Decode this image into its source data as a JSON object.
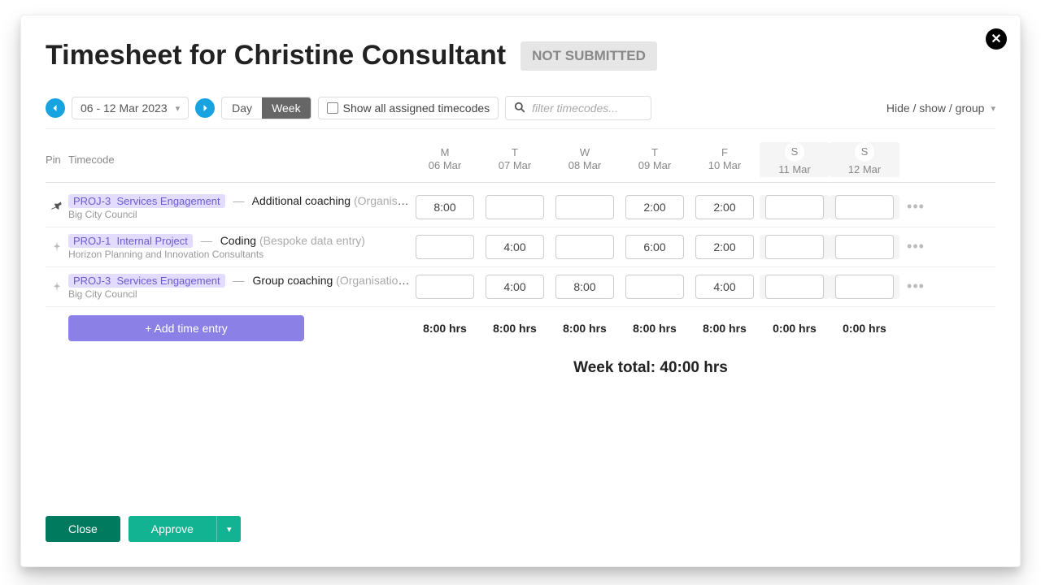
{
  "title": "Timesheet for Christine Consultant",
  "status": "NOT SUBMITTED",
  "date_range": "06 - 12 Mar 2023",
  "view": {
    "day": "Day",
    "week": "Week",
    "active": "week"
  },
  "show_all_label": "Show all assigned timecodes",
  "filter_placeholder": "filter timecodes...",
  "hide_show_label": "Hide / show / group",
  "columns": {
    "pin": "Pin",
    "timecode": "Timecode"
  },
  "days": [
    {
      "dow": "M",
      "date": "06 Mar",
      "weekend": false
    },
    {
      "dow": "T",
      "date": "07 Mar",
      "weekend": false
    },
    {
      "dow": "W",
      "date": "08 Mar",
      "weekend": false
    },
    {
      "dow": "T",
      "date": "09 Mar",
      "weekend": false
    },
    {
      "dow": "F",
      "date": "10 Mar",
      "weekend": false
    },
    {
      "dow": "S",
      "date": "11 Mar",
      "weekend": true
    },
    {
      "dow": "S",
      "date": "12 Mar",
      "weekend": true
    }
  ],
  "rows": [
    {
      "pinned": true,
      "proj_code": "PROJ-3",
      "proj_name": "Services Engagement",
      "task": "Additional coaching",
      "parens": "(Organisati...",
      "org": "Big City Council",
      "times": [
        "8:00",
        "",
        "",
        "2:00",
        "2:00",
        "",
        ""
      ]
    },
    {
      "pinned": false,
      "proj_code": "PROJ-1",
      "proj_name": "Internal Project",
      "task": "Coding",
      "parens": "(Bespoke data entry)",
      "org": "Horizon Planning and Innovation Consultants",
      "times": [
        "",
        "4:00",
        "",
        "6:00",
        "2:00",
        "",
        ""
      ]
    },
    {
      "pinned": false,
      "proj_code": "PROJ-3",
      "proj_name": "Services Engagement",
      "task": "Group coaching",
      "parens": "(Organisation fi...",
      "org": "Big City Council",
      "times": [
        "",
        "4:00",
        "8:00",
        "",
        "4:00",
        "",
        ""
      ]
    }
  ],
  "add_entry_label": "+ Add time entry",
  "day_totals": [
    "8:00 hrs",
    "8:00 hrs",
    "8:00 hrs",
    "8:00 hrs",
    "8:00 hrs",
    "0:00 hrs",
    "0:00 hrs"
  ],
  "week_total": "Week total: 40:00 hrs",
  "footer": {
    "close": "Close",
    "approve": "Approve"
  }
}
